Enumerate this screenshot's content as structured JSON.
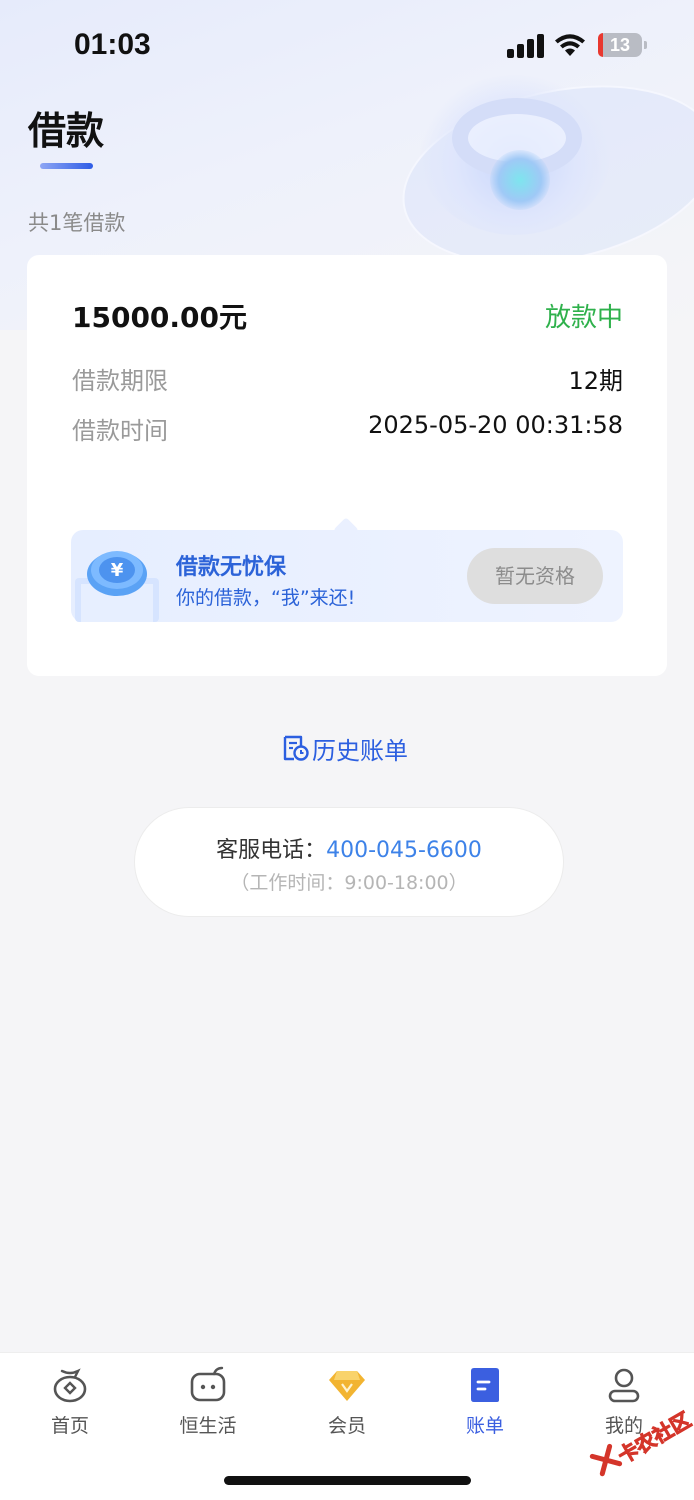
{
  "status_bar": {
    "time": "01:03",
    "battery": "13"
  },
  "page": {
    "title": "借款",
    "loan_count": "共1笔借款"
  },
  "loan": {
    "amount": "15000.00元",
    "status": "放款中",
    "status_color": "#2fb14c",
    "term_label": "借款期限",
    "term_value": "12期",
    "time_label": "借款时间",
    "time_value": "2025-05-20 00:31:58"
  },
  "promo": {
    "title": "借款无忧保",
    "subtitle": "你的借款，“我”来还!",
    "button_label": "暂无资格",
    "icon": "coin-icon"
  },
  "history": {
    "label": "历史账单",
    "icon": "bill-history-icon"
  },
  "service": {
    "label": "客服电话：",
    "phone": "400-045-6600",
    "hours": "（工作时间：9:00-18:00）"
  },
  "tabs": [
    {
      "label": "首页",
      "icon": "home-icon"
    },
    {
      "label": "恒生活",
      "icon": "life-icon"
    },
    {
      "label": "会员",
      "icon": "diamond-icon"
    },
    {
      "label": "账单",
      "icon": "bill-icon",
      "active": true
    },
    {
      "label": "我的",
      "icon": "profile-icon"
    }
  ],
  "watermark": "卡农社区",
  "colors": {
    "accent": "#3b5fe0",
    "link": "#3d82e8"
  }
}
